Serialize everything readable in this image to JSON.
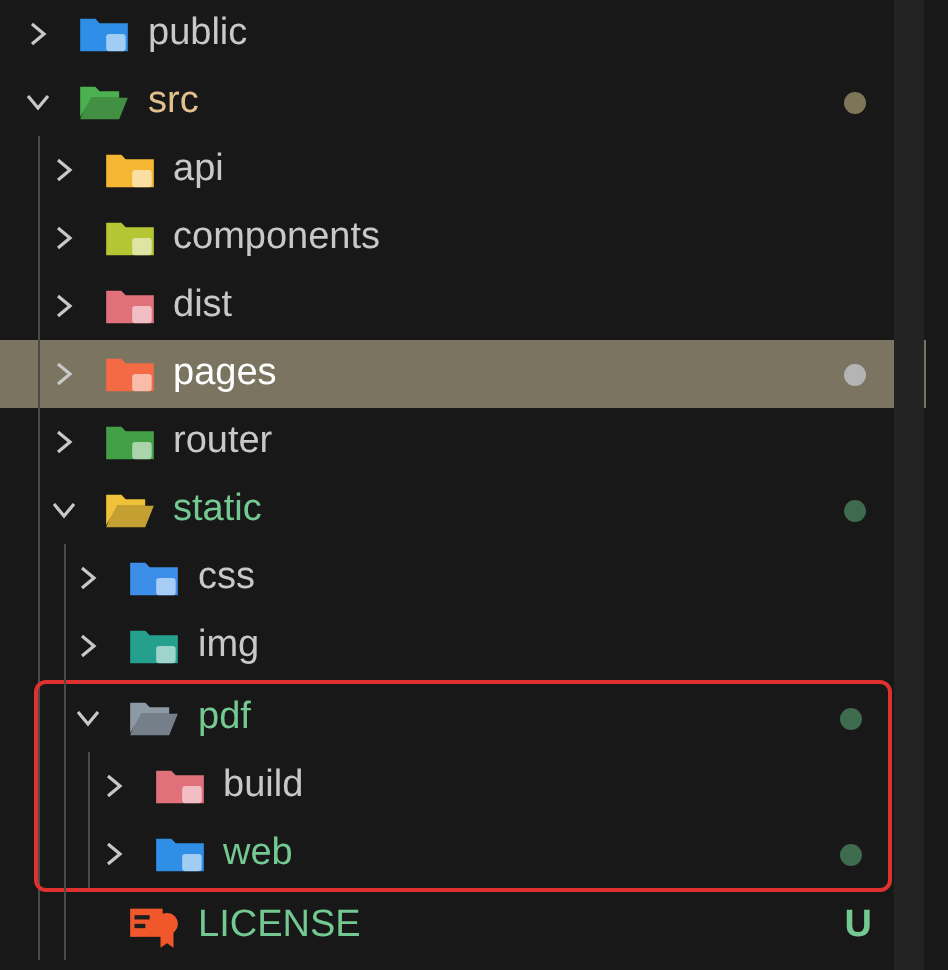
{
  "tree": [
    {
      "kind": "folder",
      "name": "public",
      "color": "#2f8ee6",
      "expanded": false,
      "selected": false,
      "modified": false,
      "untracked": false
    },
    {
      "kind": "folder",
      "name": "src",
      "color": "#4caf50",
      "expanded": true,
      "selected": false,
      "modified": true,
      "untracked": false,
      "children": [
        {
          "kind": "folder",
          "name": "api",
          "color": "#f5b731",
          "expanded": false,
          "selected": false,
          "modified": false,
          "untracked": false
        },
        {
          "kind": "folder",
          "name": "components",
          "color": "#b5c534",
          "expanded": false,
          "selected": false,
          "modified": false,
          "untracked": false
        },
        {
          "kind": "folder",
          "name": "dist",
          "color": "#e0707a",
          "expanded": false,
          "selected": false,
          "modified": false,
          "untracked": false
        },
        {
          "kind": "folder",
          "name": "pages",
          "color": "#f26b45",
          "expanded": false,
          "selected": true,
          "modified": true,
          "untracked": false
        },
        {
          "kind": "folder",
          "name": "router",
          "color": "#43a047",
          "expanded": false,
          "selected": false,
          "modified": false,
          "untracked": false
        },
        {
          "kind": "folder",
          "name": "static",
          "color": "#f0c23a",
          "expanded": true,
          "selected": false,
          "modified": false,
          "untracked": true,
          "children": [
            {
              "kind": "folder",
              "name": "css",
              "color": "#3d8ee8",
              "expanded": false,
              "selected": false,
              "modified": false,
              "untracked": false
            },
            {
              "kind": "folder",
              "name": "img",
              "color": "#26a08e",
              "expanded": false,
              "selected": false,
              "modified": false,
              "untracked": false
            },
            {
              "kind": "folder",
              "name": "pdf",
              "color": "#8d9aa6",
              "expanded": true,
              "selected": false,
              "modified": false,
              "untracked": true,
              "highlighted": true,
              "children": [
                {
                  "kind": "folder",
                  "name": "build",
                  "color": "#e0707a",
                  "expanded": false,
                  "selected": false,
                  "modified": false,
                  "untracked": false
                },
                {
                  "kind": "folder",
                  "name": "web",
                  "color": "#2f8ee6",
                  "expanded": false,
                  "selected": false,
                  "modified": false,
                  "untracked": true
                }
              ]
            },
            {
              "kind": "file",
              "name": "LICENSE",
              "color": "#f0582b",
              "selected": false,
              "modified": false,
              "untracked": true,
              "badge": "U"
            }
          ]
        }
      ]
    }
  ]
}
